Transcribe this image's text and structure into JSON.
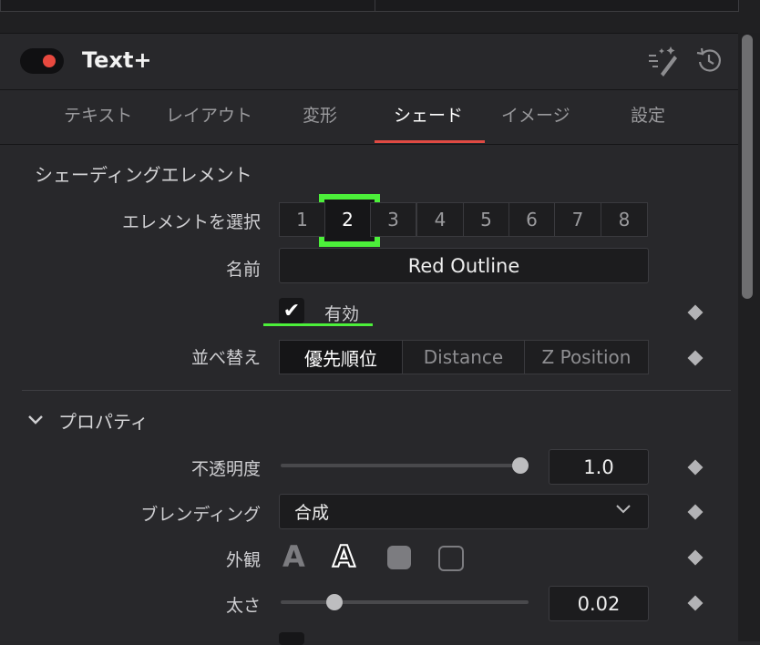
{
  "header": {
    "title": "Text+"
  },
  "tabs": [
    {
      "label": "テキスト"
    },
    {
      "label": "レイアウト"
    },
    {
      "label": "変形"
    },
    {
      "label": "シェード"
    },
    {
      "label": "イメージ"
    },
    {
      "label": "設定"
    }
  ],
  "active_tab": "シェード",
  "shading": {
    "section_title": "シェーディングエレメント",
    "select_label": "エレメントを選択",
    "elements": [
      "1",
      "2",
      "3",
      "4",
      "5",
      "6",
      "7",
      "8"
    ],
    "selected_element": "2",
    "name_label": "名前",
    "name_value": "Red Outline",
    "enabled_label": "有効",
    "enabled": true,
    "sort_label": "並べ替え",
    "sort_options": [
      "優先順位",
      "Distance",
      "Z Position"
    ],
    "sort_selected": "優先順位"
  },
  "properties": {
    "section_title": "プロパティ",
    "opacity_label": "不透明度",
    "opacity_value": "1.0",
    "blending_label": "ブレンディング",
    "blending_value": "合成",
    "appearance_label": "外観",
    "thickness_label": "太さ",
    "thickness_value": "0.02"
  },
  "icons": [
    "wand-icon",
    "reset-icon",
    "chevron-down-icon",
    "check-icon",
    "keyframe-diamond-icon"
  ],
  "colors": {
    "accent_red": "#e04a43",
    "highlight_green": "#4cf03a",
    "toggle_dot": "#e8493f"
  }
}
